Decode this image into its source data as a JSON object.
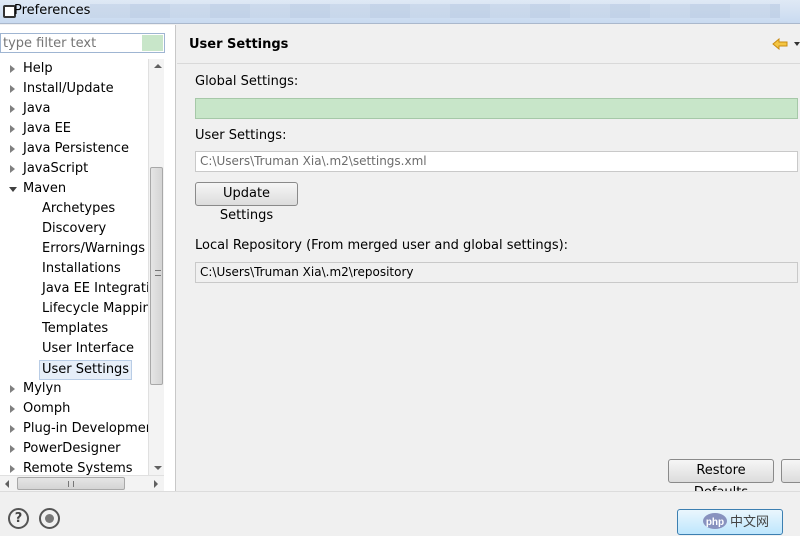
{
  "window": {
    "title": "Preferences"
  },
  "filter": {
    "placeholder": "type filter text"
  },
  "tree": [
    {
      "label": "Help",
      "level": 0,
      "twisty": "closed"
    },
    {
      "label": "Install/Update",
      "level": 0,
      "twisty": "closed"
    },
    {
      "label": "Java",
      "level": 0,
      "twisty": "closed"
    },
    {
      "label": "Java EE",
      "level": 0,
      "twisty": "closed"
    },
    {
      "label": "Java Persistence",
      "level": 0,
      "twisty": "closed"
    },
    {
      "label": "JavaScript",
      "level": 0,
      "twisty": "closed"
    },
    {
      "label": "Maven",
      "level": 0,
      "twisty": "open"
    },
    {
      "label": "Archetypes",
      "level": 1,
      "twisty": "none"
    },
    {
      "label": "Discovery",
      "level": 1,
      "twisty": "none"
    },
    {
      "label": "Errors/Warnings",
      "level": 1,
      "twisty": "none"
    },
    {
      "label": "Installations",
      "level": 1,
      "twisty": "none"
    },
    {
      "label": "Java EE Integration",
      "level": 1,
      "twisty": "none"
    },
    {
      "label": "Lifecycle Mappings",
      "level": 1,
      "twisty": "none"
    },
    {
      "label": "Templates",
      "level": 1,
      "twisty": "none"
    },
    {
      "label": "User Interface",
      "level": 1,
      "twisty": "none"
    },
    {
      "label": "User Settings",
      "level": 1,
      "twisty": "none",
      "selected": true
    },
    {
      "label": "Mylyn",
      "level": 0,
      "twisty": "closed"
    },
    {
      "label": "Oomph",
      "level": 0,
      "twisty": "closed"
    },
    {
      "label": "Plug-in Development",
      "level": 0,
      "twisty": "closed"
    },
    {
      "label": "PowerDesigner",
      "level": 0,
      "twisty": "closed"
    },
    {
      "label": "Remote Systems",
      "level": 0,
      "twisty": "closed"
    }
  ],
  "page": {
    "title": "User Settings",
    "global_label": "Global Settings:",
    "global_value": "",
    "user_label": "User Settings:",
    "user_value": "C:\\Users\\Truman Xia\\.m2\\settings.xml",
    "update_button": "Update Settings",
    "repo_label": "Local Repository (From merged user and global settings):",
    "repo_value": "C:\\Users\\Truman Xia\\.m2\\repository",
    "restore_button": "Restore Defaults"
  },
  "watermark": {
    "text": "php中文网"
  },
  "colors": {
    "highlight_green": "#c8e6c9",
    "selection": "#e6eef8",
    "arrow_icon": "#e3a21a"
  }
}
